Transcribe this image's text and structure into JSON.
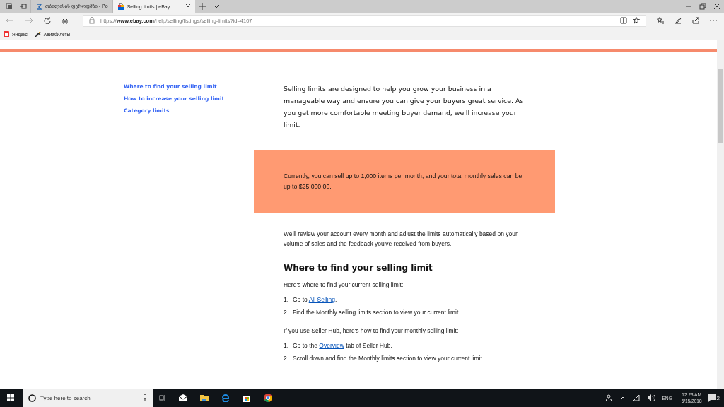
{
  "browser": {
    "tabs": [
      {
        "title": "თბილისის ფეროფმბი - Po",
        "selected": false
      },
      {
        "title": "Selling limits | eBay",
        "selected": true
      }
    ],
    "url_scheme": "https://",
    "url_host": "www.ebay.com",
    "url_path": "/help/selling/listings/selling-limits?id=4107",
    "favorites": [
      {
        "label": "Яндекс"
      },
      {
        "label": "Авиабилеты"
      }
    ]
  },
  "page": {
    "nav": [
      {
        "label": "Where to find your selling limit"
      },
      {
        "label": "How to increase your selling limit"
      },
      {
        "label": "Category limits"
      }
    ],
    "intro": "Selling limits are designed to help you grow your business in a manageable way and ensure you can give your buyers great service. As you get more comfortable meeting buyer demand, we'll increase your limit.",
    "notice": "Currently, you can sell up to 1,000 items per month, and your total monthly sales can be up to $25,000.00.",
    "review": "We'll review your account every month and adjust the limits automatically based on your volume of sales and the feedback you've received from buyers.",
    "heading": "Where to find your selling limit",
    "blocks": [
      {
        "text": "Here's where to find your current selling limit:",
        "steps": [
          {
            "number": "1.",
            "before": "Go to ",
            "link": "All Selling",
            "after": "."
          },
          {
            "number": "2.",
            "before": "Find the Monthly selling limits section to view your current limit."
          }
        ]
      },
      {
        "text": "If you use Seller Hub, here's how to find your monthly selling limit:",
        "steps": [
          {
            "number": "1.",
            "before": "Go to the ",
            "link": "Overview",
            "after": " tab of Seller Hub."
          },
          {
            "number": "2.",
            "before": "Scroll down and find the Monthly limits section to view your current limit."
          }
        ]
      }
    ]
  },
  "taskbar": {
    "search_placeholder": "Type here to search",
    "language": "ENG",
    "time": "12:23 AM",
    "date": "6/15/2018",
    "notification_count": "2"
  }
}
